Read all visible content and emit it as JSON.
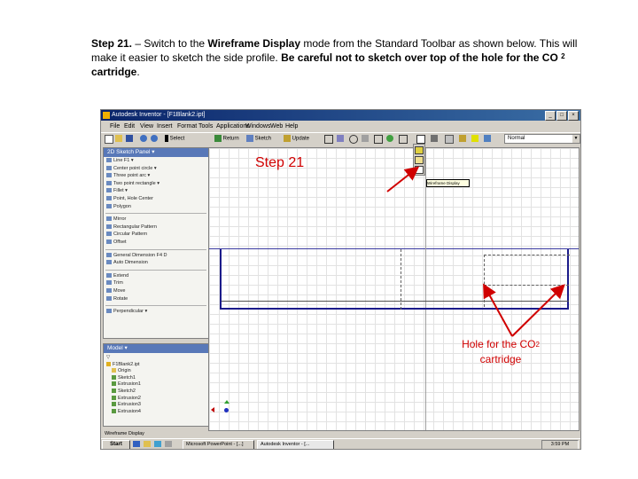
{
  "instruction": {
    "step_label": "Step 21.",
    "text_1": " – Switch to the ",
    "mode_name": "Wireframe Display",
    "text_2": " mode from the Standard Toolbar as shown below. This will make it easier to sketch the side profile. ",
    "warning": "Be careful not to sketch over top of the hole for the CO",
    "warning_sup": "2",
    "warning_end": " cartridge",
    "end": "."
  },
  "screenshot": {
    "window_title": "Autodesk Inventor - [F1Blank2.ipt]",
    "menu": [
      "File",
      "Edit",
      "View",
      "Insert",
      "Format",
      "Tools",
      "Applications",
      "Windows",
      "Web",
      "Help"
    ],
    "toolbar": {
      "select_label": "Select",
      "return_label": "Return",
      "sketch_label": "Sketch",
      "update_label": "Update",
      "style_dropdown": "Normal"
    },
    "sketch_panel": {
      "title": "2D Sketch Panel ▾",
      "tools": [
        "Line  F1 ▾",
        "Center point circle ▾",
        "Three point arc ▾",
        "Two point rectangle ▾",
        "Fillet ▾",
        "Point, Hole Center",
        "Polygon",
        "Mirror",
        "Rectangular Pattern",
        "Circular Pattern",
        "Offset",
        "General Dimension  F4 D",
        "Auto Dimension",
        "Extend",
        "Trim",
        "Move",
        "Rotate",
        "Perpendicular ▾"
      ]
    },
    "browser": {
      "title": "Model ▾",
      "nodes": [
        "F1Blank2.ipt",
        "Origin",
        "Sketch1",
        "Extrusion1",
        "Sketch2",
        "Extrusion2",
        "Extrusion3",
        "Extrusion4"
      ]
    },
    "tooltip": "Wireframe Display",
    "status_text": "Wireframe Display",
    "taskbar": {
      "start": "Start",
      "tasks": [
        "Microsoft PowerPoint - [...]",
        "Autodesk Inventor - [..."
      ],
      "clock": "3:59 PM"
    }
  },
  "callouts": {
    "step": "Step 21",
    "hole_line1": "Hole for the CO",
    "hole_sup": "2",
    "hole_line2": "cartridge"
  },
  "colors": {
    "callout": "#d00000",
    "title_bar": "#0a246a",
    "sketch_outline": "#1a1a8a"
  }
}
